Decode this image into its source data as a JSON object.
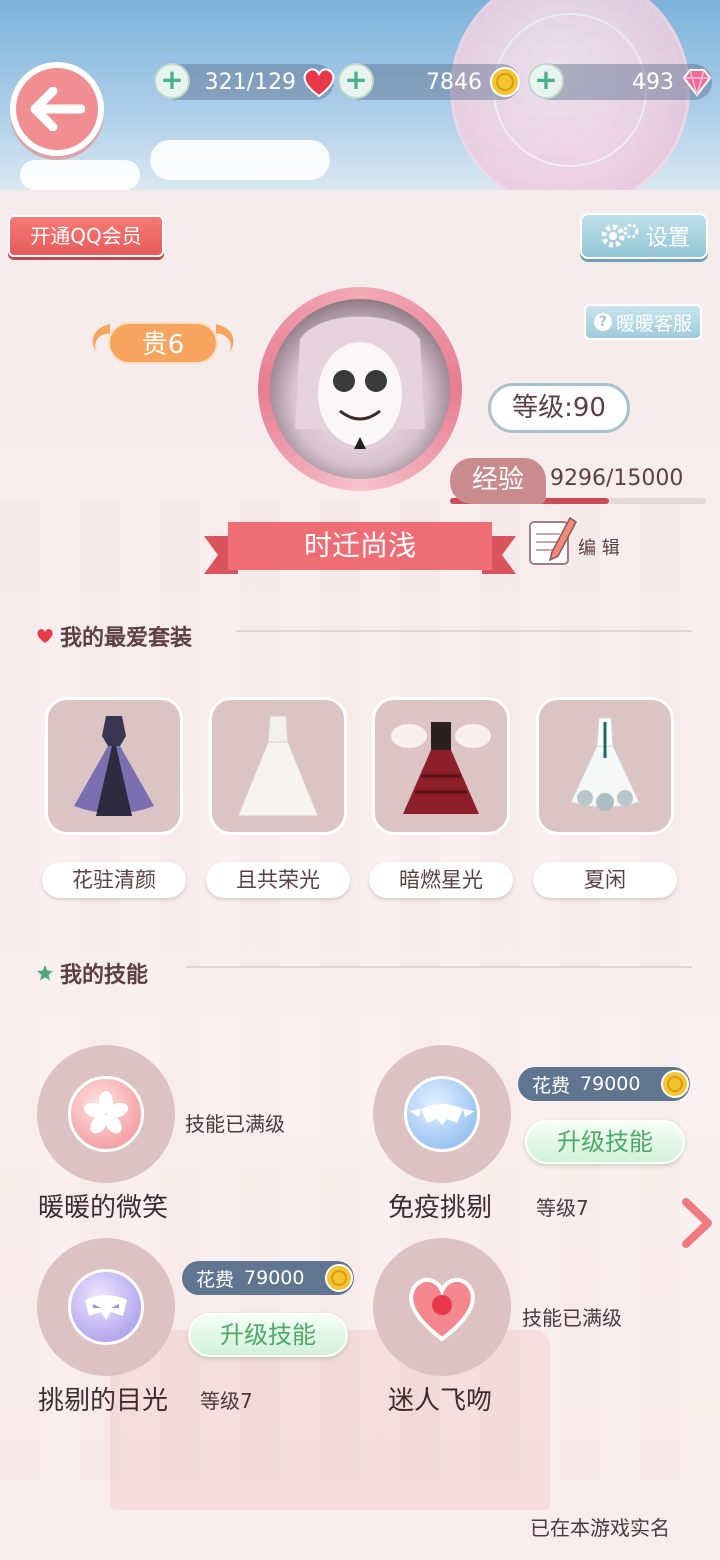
{
  "resources": {
    "stamina": "321/129",
    "gold": "7846",
    "diamond": "493"
  },
  "buttons": {
    "qq_member": "开通QQ会员",
    "settings": "设置",
    "customer_service": "暖暖客服",
    "edit": "编 辑"
  },
  "profile": {
    "noble": "贵6",
    "level": "等级:90",
    "exp_label": "经验",
    "exp_value": "9296/15000",
    "exp_fraction": 0.62,
    "name": "时迁尚浅"
  },
  "favorites": {
    "title": "我的最爱套装",
    "items": [
      {
        "label": "花驻清颜"
      },
      {
        "label": "且共荣光"
      },
      {
        "label": "暗燃星光"
      },
      {
        "label": "夏闲"
      }
    ]
  },
  "skills": {
    "title": "我的技能",
    "items": [
      {
        "name": "暖暖的微笑",
        "status": "技能已满级"
      },
      {
        "name": "免疫挑剔",
        "cost_label": "花费",
        "cost": "79000",
        "upgrade": "升级技能",
        "level": "等级7"
      },
      {
        "name": "挑剔的目光",
        "cost_label": "花费",
        "cost": "79000",
        "upgrade": "升级技能",
        "level": "等级7"
      },
      {
        "name": "迷人飞吻",
        "status": "技能已满级"
      }
    ]
  },
  "footer": {
    "realname": "已在本游戏实名"
  },
  "colors": {
    "accent_red": "#e55c5a",
    "ribbon": "#e8636b",
    "upgrade_green": "#4ea86c",
    "tag_blue": "#607590"
  }
}
